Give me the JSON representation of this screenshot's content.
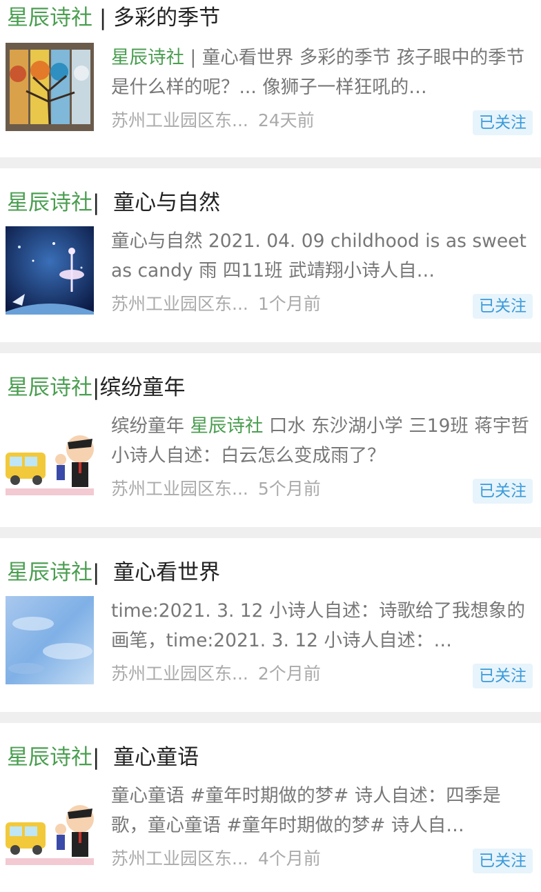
{
  "articles": [
    {
      "title_brand": "星辰诗社",
      "title_rest": " | 多彩的季节",
      "thumb_icon": "seasons-tree-icon",
      "snippet_brand": "星辰诗社",
      "snippet": " | 童心看世界 多彩的季节 孩子眼中的季节是什么样的呢？... 像狮子一样狂吼的…",
      "location": "苏州工业园区东...",
      "time": "24天前",
      "follow": "已关注"
    },
    {
      "title_brand": "星辰诗社",
      "title_rest": "|  童心与自然",
      "thumb_icon": "night-sky-dancer-icon",
      "snippet_brand": "",
      "snippet": "童心与自然 2021. 04. 09 childhood is as sweet as candy 雨 四11班 武靖翔小诗人自…",
      "location": "苏州工业园区东...",
      "time": "1个月前",
      "follow": "已关注"
    },
    {
      "title_brand": "星辰诗社",
      "title_rest": "|缤纷童年",
      "thumb_icon": "school-bus-kids-icon",
      "snippet_pre": "缤纷童年 ",
      "snippet_brand": "星辰诗社",
      "snippet": " 口水 东沙湖小学 三19班 蒋宇哲 小诗人自述：白云怎么变成雨了？",
      "location": "苏州工业园区东...",
      "time": "5个月前",
      "follow": "已关注"
    },
    {
      "title_brand": "星辰诗社",
      "title_rest": "|  童心看世界",
      "thumb_icon": "watercolor-sky-icon",
      "snippet_brand": "",
      "snippet": "time:2021. 3. 12 小诗人自述：诗歌给了我想象的画笔，time:2021. 3. 12 小诗人自述：…",
      "location": "苏州工业园区东...",
      "time": "2个月前",
      "follow": "已关注"
    },
    {
      "title_brand": "星辰诗社",
      "title_rest": "|  童心童语",
      "thumb_icon": "school-bus-kids-icon",
      "snippet_brand": "",
      "snippet": "童心童语 #童年时期做的梦# 诗人自述：四季是歌，童心童语 #童年时期做的梦# 诗人自…",
      "location": "苏州工业园区东...",
      "time": "4个月前",
      "follow": "已关注"
    }
  ]
}
